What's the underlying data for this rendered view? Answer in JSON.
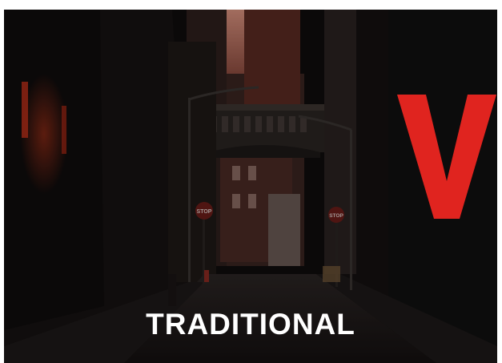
{
  "image": {
    "description_color_palette": {
      "sky": "#c9877a",
      "accent_red": "#e0241f",
      "dark": "#0f0d0d"
    }
  },
  "caption": {
    "text": "TRADITIONAL"
  },
  "brand_mark": {
    "letter": "V",
    "color": "#e0241f"
  },
  "street_signs": {
    "stop_left": "STOP",
    "stop_right": "STOP"
  }
}
